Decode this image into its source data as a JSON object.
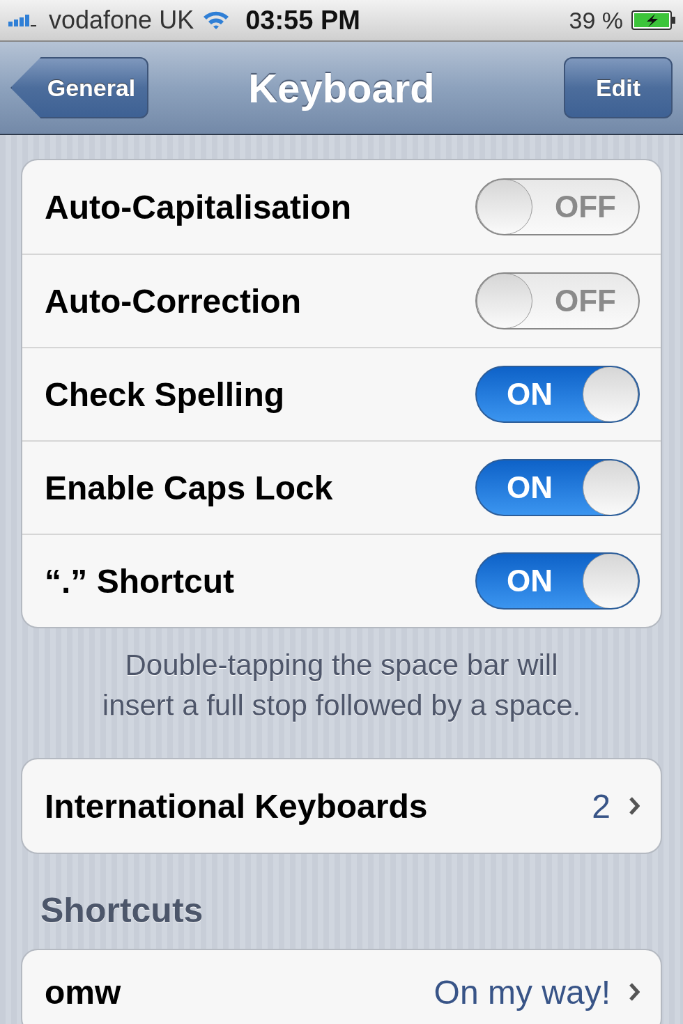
{
  "status_bar": {
    "carrier": "vodafone UK",
    "time": "03:55 PM",
    "battery": "39 %"
  },
  "nav": {
    "back": "General",
    "title": "Keyboard",
    "action": "Edit"
  },
  "settings": [
    {
      "label": "Auto-Capitalisation",
      "on": false,
      "switch_text": "OFF"
    },
    {
      "label": "Auto-Correction",
      "on": false,
      "switch_text": "OFF"
    },
    {
      "label": "Check Spelling",
      "on": true,
      "switch_text": "ON"
    },
    {
      "label": "Enable Caps Lock",
      "on": true,
      "switch_text": "ON"
    },
    {
      "label": "“.” Shortcut",
      "on": true,
      "switch_text": "ON"
    }
  ],
  "footnote": "Double-tapping the space bar will\ninsert a full stop followed by a space.",
  "international": {
    "label": "International Keyboards",
    "value": "2"
  },
  "shortcuts_header": "Shortcuts",
  "shortcuts": [
    {
      "label": "omw",
      "value": "On my way!"
    }
  ]
}
